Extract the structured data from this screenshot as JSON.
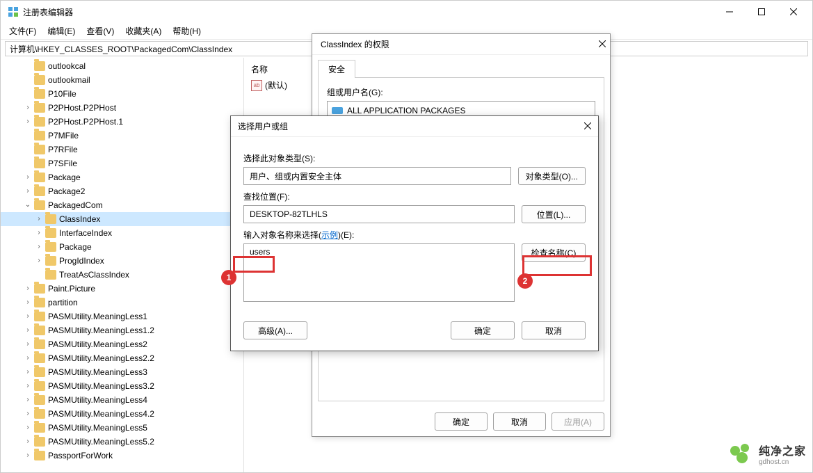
{
  "app": {
    "title": "注册表编辑器"
  },
  "menu": {
    "file": "文件(F)",
    "edit": "编辑(E)",
    "view": "查看(V)",
    "fav": "收藏夹(A)",
    "help": "帮助(H)"
  },
  "address": "计算机\\HKEY_CLASSES_ROOT\\PackagedCom\\ClassIndex",
  "tree": [
    {
      "indent": 2,
      "label": "outlookcal",
      "exp": ""
    },
    {
      "indent": 2,
      "label": "outlookmail",
      "exp": ""
    },
    {
      "indent": 2,
      "label": "P10File",
      "exp": ""
    },
    {
      "indent": 2,
      "label": "P2PHost.P2PHost",
      "exp": ">"
    },
    {
      "indent": 2,
      "label": "P2PHost.P2PHost.1",
      "exp": ">"
    },
    {
      "indent": 2,
      "label": "P7MFile",
      "exp": ""
    },
    {
      "indent": 2,
      "label": "P7RFile",
      "exp": ""
    },
    {
      "indent": 2,
      "label": "P7SFile",
      "exp": ""
    },
    {
      "indent": 2,
      "label": "Package",
      "exp": ">"
    },
    {
      "indent": 2,
      "label": "Package2",
      "exp": ">"
    },
    {
      "indent": 2,
      "label": "PackagedCom",
      "exp": "v"
    },
    {
      "indent": 3,
      "label": "ClassIndex",
      "exp": ">",
      "selected": true
    },
    {
      "indent": 3,
      "label": "InterfaceIndex",
      "exp": ">"
    },
    {
      "indent": 3,
      "label": "Package",
      "exp": ">"
    },
    {
      "indent": 3,
      "label": "ProgIdIndex",
      "exp": ">"
    },
    {
      "indent": 3,
      "label": "TreatAsClassIndex",
      "exp": ""
    },
    {
      "indent": 2,
      "label": "Paint.Picture",
      "exp": ">"
    },
    {
      "indent": 2,
      "label": "partition",
      "exp": ">"
    },
    {
      "indent": 2,
      "label": "PASMUtility.MeaningLess1",
      "exp": ">"
    },
    {
      "indent": 2,
      "label": "PASMUtility.MeaningLess1.2",
      "exp": ">"
    },
    {
      "indent": 2,
      "label": "PASMUtility.MeaningLess2",
      "exp": ">"
    },
    {
      "indent": 2,
      "label": "PASMUtility.MeaningLess2.2",
      "exp": ">"
    },
    {
      "indent": 2,
      "label": "PASMUtility.MeaningLess3",
      "exp": ">"
    },
    {
      "indent": 2,
      "label": "PASMUtility.MeaningLess3.2",
      "exp": ">"
    },
    {
      "indent": 2,
      "label": "PASMUtility.MeaningLess4",
      "exp": ">"
    },
    {
      "indent": 2,
      "label": "PASMUtility.MeaningLess4.2",
      "exp": ">"
    },
    {
      "indent": 2,
      "label": "PASMUtility.MeaningLess5",
      "exp": ">"
    },
    {
      "indent": 2,
      "label": "PASMUtility.MeaningLess5.2",
      "exp": ">"
    },
    {
      "indent": 2,
      "label": "PassportForWork",
      "exp": ">"
    }
  ],
  "valuepanel": {
    "header": "名称",
    "default_value": "(默认)"
  },
  "perm": {
    "title": "ClassIndex 的权限",
    "tab": "安全",
    "group_label": "组或用户名(G):",
    "list_item": "ALL APPLICATION PACKAGES",
    "ok": "确定",
    "cancel": "取消",
    "apply": "应用(A)"
  },
  "select": {
    "title": "选择用户或组",
    "type_label": "选择此对象类型(S):",
    "type_value": "用户、组或内置安全主体",
    "type_btn": "对象类型(O)...",
    "loc_label": "查找位置(F):",
    "loc_value": "DESKTOP-82TLHLS",
    "loc_btn": "位置(L)...",
    "name_label_prefix": "输入对象名称来选择(",
    "name_label_link": "示例",
    "name_label_suffix": ")(E):",
    "name_value": "users",
    "check_btn": "检查名称(C)",
    "advanced": "高级(A)...",
    "ok": "确定",
    "cancel": "取消"
  },
  "annot": {
    "n1": "1",
    "n2": "2"
  },
  "watermark": {
    "name": "纯净之家",
    "url": "gdhost.cn"
  }
}
